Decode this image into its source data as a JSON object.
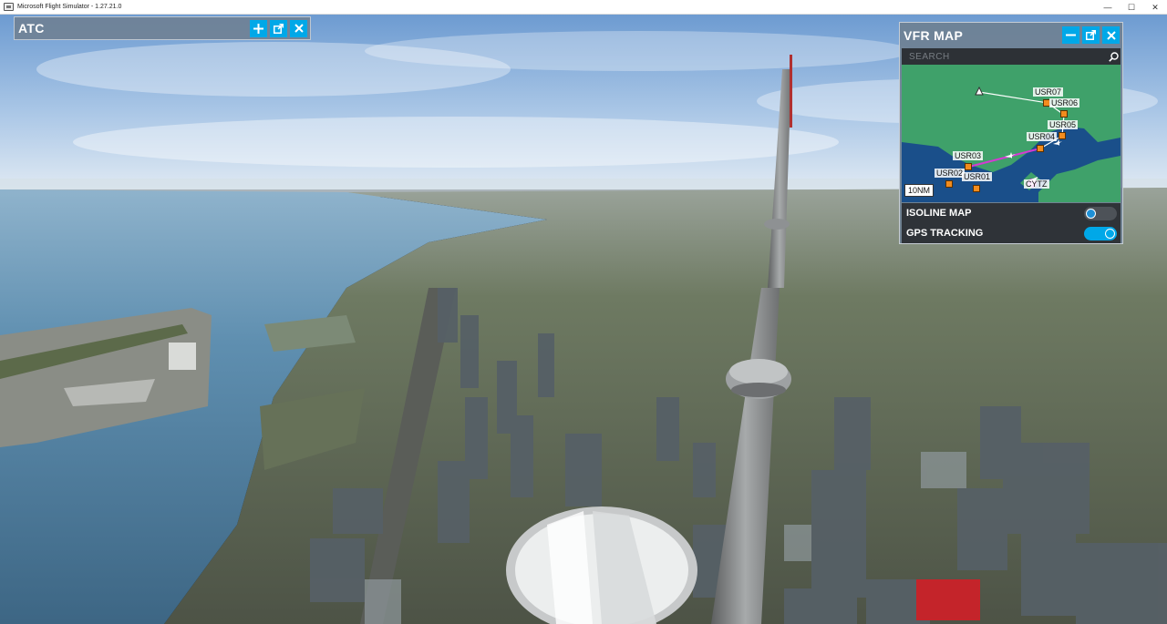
{
  "window": {
    "title": "Microsoft Flight Simulator - 1.27.21.0",
    "minimize_glyph": "—",
    "maximize_glyph": "☐",
    "close_glyph": "✕"
  },
  "atc_panel": {
    "title": "ATC",
    "buttons": [
      "plus-icon",
      "popout-icon",
      "close-icon"
    ]
  },
  "vfr_panel": {
    "title": "VFR MAP",
    "search_placeholder": "SEARCH",
    "buttons": [
      "minimize-icon",
      "popout-icon",
      "close-icon"
    ],
    "scale": "10NM",
    "waypoints": [
      "USR07",
      "USR06",
      "USR05",
      "USR04",
      "USR03",
      "USR02",
      "USR01"
    ],
    "airport": "CYTZ",
    "toggles": [
      {
        "label": "ISOLINE MAP",
        "on": false
      },
      {
        "label": "GPS TRACKING",
        "on": true
      }
    ]
  },
  "colors": {
    "accent": "#00a8e8",
    "map_water": "#1a4f8a",
    "map_land": "#3fa16a",
    "route": "#d33ad3",
    "waypoint": "#f28c1e"
  }
}
